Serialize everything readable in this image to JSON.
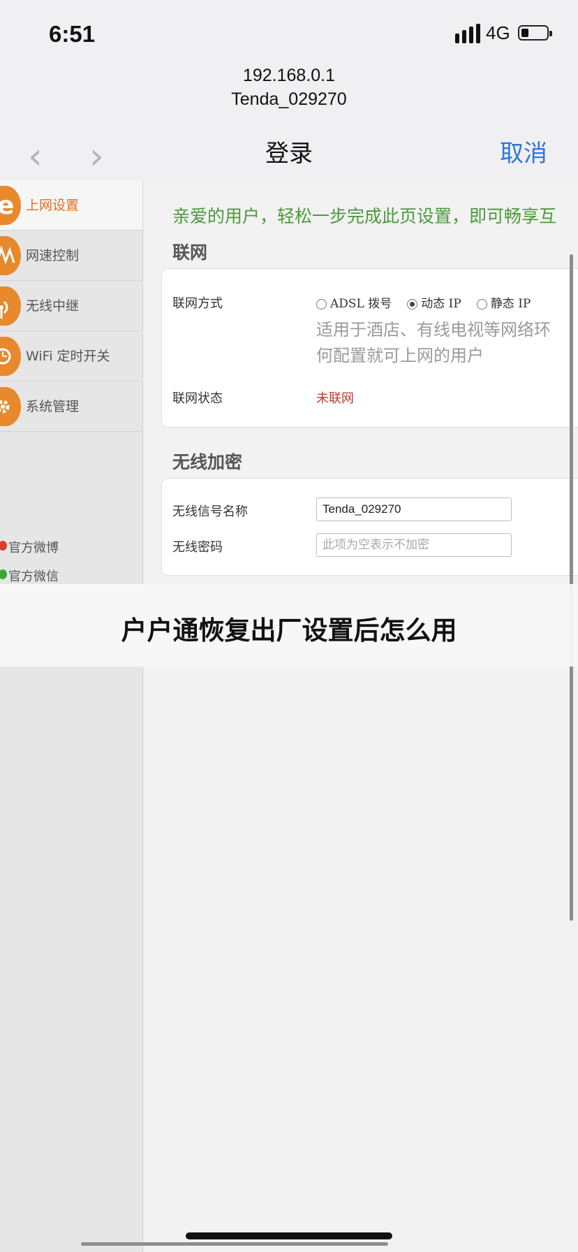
{
  "status_bar": {
    "time": "6:51",
    "network": "4G",
    "signal_icon": "signal-bars-icon",
    "battery_icon": "battery-low-icon"
  },
  "browser": {
    "host": "192.168.0.1",
    "ssid": "Tenda_029270",
    "title": "登录",
    "cancel": "取消",
    "back_icon": "chevron-left-icon",
    "forward_icon": "chevron-right-icon"
  },
  "sidebar": {
    "items": [
      {
        "label": "上网设置",
        "icon": "internet-e-icon",
        "active": true
      },
      {
        "label": "网速控制",
        "icon": "speed-wave-icon",
        "active": false
      },
      {
        "label": "无线中继",
        "icon": "wireless-relay-icon",
        "active": false
      },
      {
        "label": "WiFi 定时开关",
        "icon": "wifi-timer-icon",
        "active": false
      },
      {
        "label": "系统管理",
        "icon": "gear-icon",
        "active": false
      }
    ],
    "social": [
      {
        "label": "官方微博",
        "icon": "weibo-icon",
        "color": "#d9412a"
      },
      {
        "label": "官方微信",
        "icon": "wechat-icon",
        "color": "#3aa93a"
      }
    ]
  },
  "main": {
    "welcome": "亲爱的用户，轻松一步完成此页设置，即可畅享互",
    "network": {
      "title": "联网",
      "mode_label": "联网方式",
      "options": [
        "ADSL 拨号",
        "动态 IP",
        "静态 IP"
      ],
      "selected": "动态 IP",
      "hint_line1": "适用于酒店、有线电视等网络环",
      "hint_line2": "何配置就可上网的用户",
      "status_label": "联网状态",
      "status_value": "未联网"
    },
    "wireless": {
      "title": "无线加密",
      "ssid_label": "无线信号名称",
      "ssid_value": "Tenda_029270",
      "password_label": "无线密码",
      "password_placeholder": "此项为空表示不加密"
    }
  },
  "overlay": {
    "caption": "户户通恢复出厂设置后怎么用"
  },
  "colors": {
    "accent_orange": "#e8892d",
    "link_blue": "#2f77d1",
    "welcome_green": "#4a9a3c",
    "status_red": "#c0392b"
  }
}
